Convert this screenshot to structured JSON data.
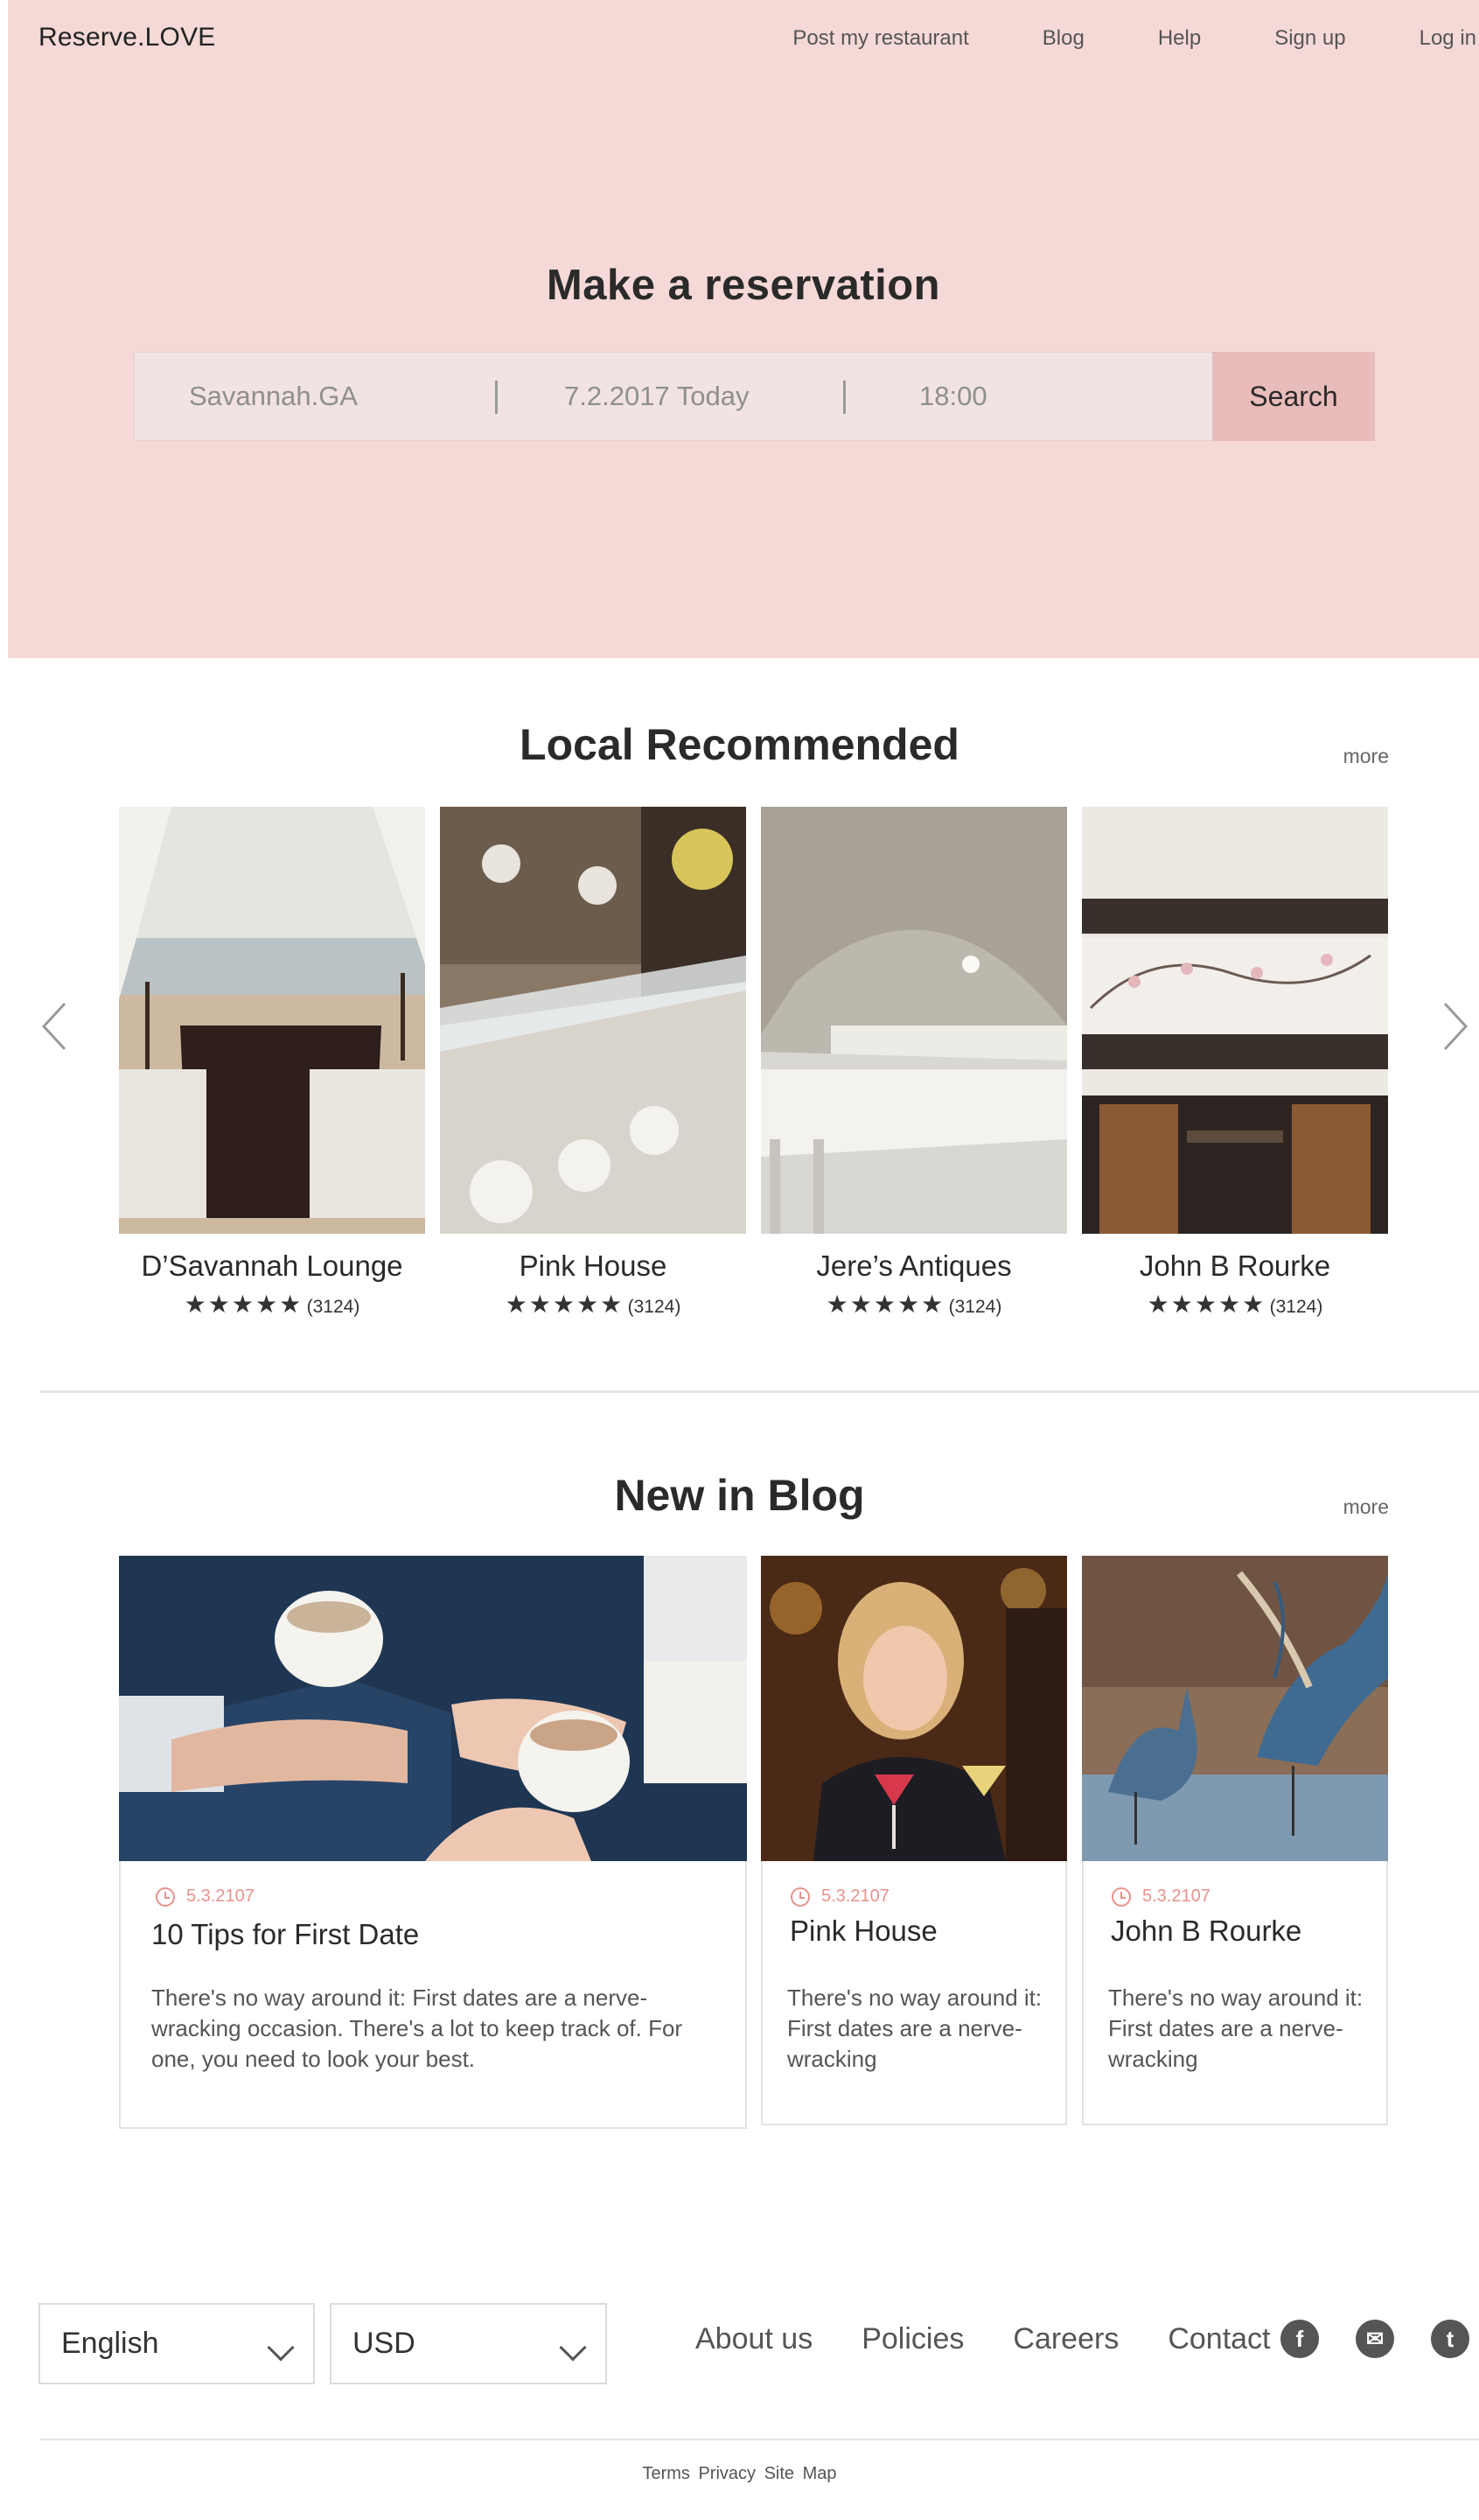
{
  "header": {
    "logo": "Reserve.LOVE",
    "nav": [
      "Post my restaurant",
      "Blog",
      "Help",
      "Sign up",
      "Log in"
    ]
  },
  "hero": {
    "title": "Make a reservation",
    "search": {
      "city": "Savannah.GA",
      "date": "7.2.2017 Today",
      "time": "18:00",
      "button": "Search"
    }
  },
  "recommended": {
    "title": "Local Recommended",
    "more": "more",
    "items": [
      {
        "name": "D’Savannah Lounge",
        "stars": "★★★★★",
        "count": "(3124)"
      },
      {
        "name": "Pink House",
        "stars": "★★★★★",
        "count": "(3124)"
      },
      {
        "name": "Jere’s Antiques",
        "stars": "★★★★★",
        "count": "(3124)"
      },
      {
        "name": "John B Rourke",
        "stars": "★★★★★",
        "count": "(3124)"
      }
    ]
  },
  "blog": {
    "title": "New in Blog",
    "more": "more",
    "posts": [
      {
        "date": "5.3.2107",
        "title": "10 Tips for First Date",
        "excerpt": "There's no way around it: First dates are a nerve-wracking occasion. There's a lot to keep track of. For one, you need to look your best."
      },
      {
        "date": "5.3.2107",
        "title": "Pink House",
        "excerpt": "There's no way around it: First dates are a nerve-wracking"
      },
      {
        "date": "5.3.2107",
        "title": "John B Rourke",
        "excerpt": "There's no way around it: First dates are a nerve-wracking"
      }
    ]
  },
  "footer": {
    "language": "English",
    "currency": "USD",
    "links": [
      "About us",
      "Policies",
      "Careers",
      "Contact"
    ],
    "social": [
      "f",
      "✉",
      "t"
    ],
    "legal": "Terms Privacy Site Map"
  },
  "icons": [
    "chevron-left-icon",
    "chevron-right-icon",
    "star-icon",
    "clock-icon",
    "chevron-down-icon",
    "facebook-icon",
    "email-icon",
    "tumblr-icon"
  ],
  "colors": {
    "hero_bg": "#f5d9d7",
    "search_button": "#e8bcba",
    "accent_date": "#e9928c"
  }
}
